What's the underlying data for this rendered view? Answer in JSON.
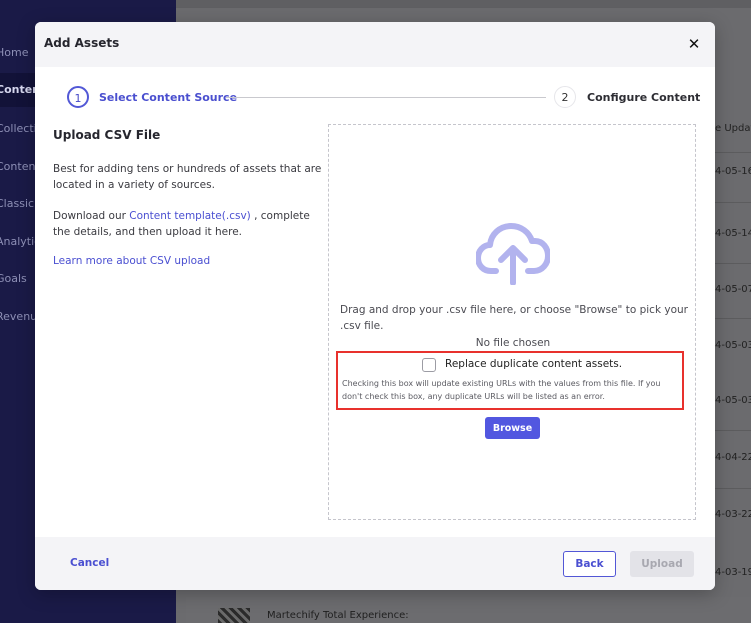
{
  "background": {
    "nav_items": [
      "Home",
      "Content",
      "Collections",
      "Content",
      "Classic B",
      "Analytics",
      "Goals",
      "Revenue"
    ],
    "column_header": "e Update",
    "dates": [
      "4-05-16",
      "4-05-14",
      "4-05-07",
      "4-05-03",
      "4-05-03",
      "4-04-22",
      "4-03-22",
      "4-03-19"
    ],
    "footer_item": "Martechify Total Experience:"
  },
  "modal": {
    "title": "Add Assets",
    "close_icon": "close-icon"
  },
  "stepper": {
    "steps": [
      {
        "number": "1",
        "label": "Select Content Source",
        "active": true
      },
      {
        "number": "2",
        "label": "Configure Content",
        "active": false
      }
    ]
  },
  "left": {
    "title": "Upload CSV File",
    "description": "Best for adding tens or hundreds of assets that are located in a variety of sources.",
    "download_prefix": "Download our ",
    "template_link": "Content template(.csv)",
    "download_suffix": " , complete the details, and then upload it here.",
    "learn_more": "Learn more about CSV upload"
  },
  "dropzone": {
    "icon": "cloud-upload-icon",
    "instructions": "Drag and drop your .csv file here, or choose \"Browse\" to pick your .csv file.",
    "file_status": "No file chosen",
    "checkbox_label": "Replace duplicate content assets.",
    "checkbox_checked": false,
    "checkbox_help": "Checking this box will update existing URLs with the values from this file. If you don't check this box, any duplicate URLs will be listed as an error.",
    "browse_label": "Browse"
  },
  "footer": {
    "cancel_label": "Cancel",
    "back_label": "Back",
    "upload_label": "Upload"
  },
  "colors": {
    "accent": "#5257e0",
    "highlight_border": "#e8312d",
    "sidebar": "#1a1a47",
    "icon": "#b2b3ee"
  }
}
